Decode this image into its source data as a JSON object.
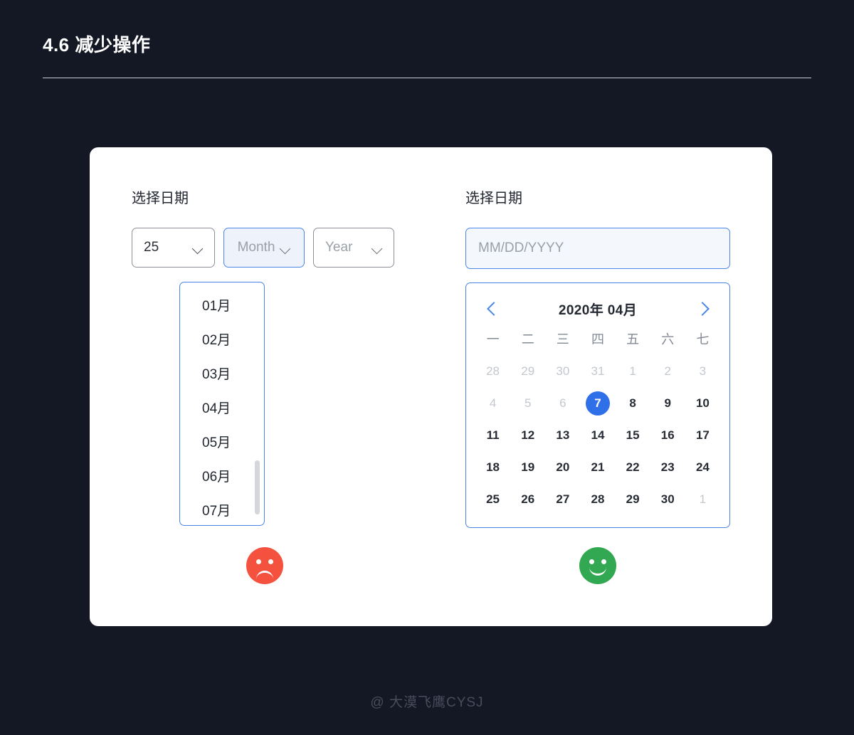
{
  "page": {
    "title": "4.6 减少操作",
    "background_color": "#141824",
    "card_color": "#ffffff",
    "accent_color": "#4a86e8",
    "selected_color": "#2f6fe8"
  },
  "left_panel": {
    "label": "选择日期",
    "selects": [
      {
        "name": "day",
        "value": "25",
        "is_placeholder": false,
        "focused": false
      },
      {
        "name": "month",
        "value": "Month",
        "is_placeholder": true,
        "focused": true
      },
      {
        "name": "year",
        "value": "Year",
        "is_placeholder": true,
        "focused": false
      }
    ],
    "dropdown": {
      "open": true,
      "items": [
        "01月",
        "02月",
        "03月",
        "04月",
        "05月",
        "06月",
        "07月"
      ],
      "scrollbar_visible": true
    },
    "verdict": {
      "type": "sad-face",
      "color": "#f4513e"
    }
  },
  "right_panel": {
    "label": "选择日期",
    "date_input": {
      "value": "",
      "placeholder": "MM/DD/YYYY"
    },
    "calendar": {
      "title": "2020年 04月",
      "prev_label": "‹",
      "next_label": "›",
      "weekdays": [
        "一",
        "二",
        "三",
        "四",
        "五",
        "六",
        "七"
      ],
      "weeks": [
        [
          {
            "d": "28",
            "state": "muted"
          },
          {
            "d": "29",
            "state": "muted"
          },
          {
            "d": "30",
            "state": "muted"
          },
          {
            "d": "31",
            "state": "muted"
          },
          {
            "d": "1",
            "state": "muted"
          },
          {
            "d": "2",
            "state": "muted"
          },
          {
            "d": "3",
            "state": "muted"
          }
        ],
        [
          {
            "d": "4",
            "state": "muted"
          },
          {
            "d": "5",
            "state": "muted"
          },
          {
            "d": "6",
            "state": "muted"
          },
          {
            "d": "7",
            "state": "selected"
          },
          {
            "d": "8",
            "state": "normal"
          },
          {
            "d": "9",
            "state": "normal"
          },
          {
            "d": "10",
            "state": "normal"
          }
        ],
        [
          {
            "d": "11",
            "state": "normal"
          },
          {
            "d": "12",
            "state": "normal"
          },
          {
            "d": "13",
            "state": "normal"
          },
          {
            "d": "14",
            "state": "normal"
          },
          {
            "d": "15",
            "state": "normal"
          },
          {
            "d": "16",
            "state": "normal"
          },
          {
            "d": "17",
            "state": "normal"
          }
        ],
        [
          {
            "d": "18",
            "state": "normal"
          },
          {
            "d": "19",
            "state": "normal"
          },
          {
            "d": "20",
            "state": "normal"
          },
          {
            "d": "21",
            "state": "normal"
          },
          {
            "d": "22",
            "state": "normal"
          },
          {
            "d": "23",
            "state": "normal"
          },
          {
            "d": "24",
            "state": "normal"
          }
        ],
        [
          {
            "d": "25",
            "state": "normal"
          },
          {
            "d": "26",
            "state": "normal"
          },
          {
            "d": "27",
            "state": "normal"
          },
          {
            "d": "28",
            "state": "normal"
          },
          {
            "d": "29",
            "state": "normal"
          },
          {
            "d": "30",
            "state": "normal"
          },
          {
            "d": "1",
            "state": "muted"
          }
        ]
      ]
    },
    "verdict": {
      "type": "happy-face",
      "color": "#32a852"
    }
  },
  "footer": {
    "watermark": "@ 大漠飞鹰CYSJ"
  }
}
